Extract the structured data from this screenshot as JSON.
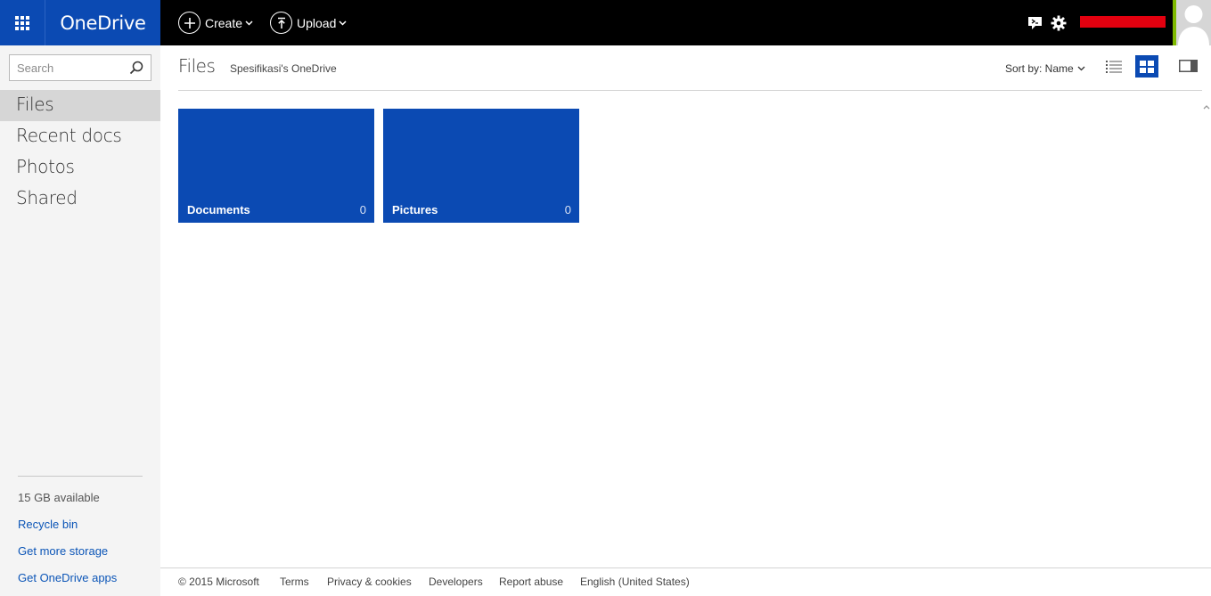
{
  "app": {
    "brand": "OneDrive"
  },
  "topbar": {
    "create_label": "Create",
    "upload_label": "Upload",
    "chevron_icon": "chevron-down-icon",
    "colors": {
      "bar": "#000000",
      "accent": "#0b4ab3",
      "redacted": "#e3000f"
    }
  },
  "search": {
    "placeholder": "Search"
  },
  "sidebar": {
    "items": [
      {
        "label": "Files",
        "active": true
      },
      {
        "label": "Recent docs",
        "active": false
      },
      {
        "label": "Photos",
        "active": false
      },
      {
        "label": "Shared",
        "active": false
      }
    ],
    "storage": "15 GB available",
    "links": [
      "Recycle bin",
      "Get more storage",
      "Get OneDrive apps"
    ]
  },
  "main": {
    "title": "Files",
    "breadcrumb": "Spesifikasi's OneDrive",
    "sort_label": "Sort by: Name",
    "tiles": [
      {
        "name": "Documents",
        "count": "0"
      },
      {
        "name": "Pictures",
        "count": "0"
      }
    ]
  },
  "footer": {
    "copyright": "© 2015 Microsoft",
    "links": [
      "Terms",
      "Privacy & cookies",
      "Developers",
      "Report abuse",
      "English (United States)"
    ]
  }
}
